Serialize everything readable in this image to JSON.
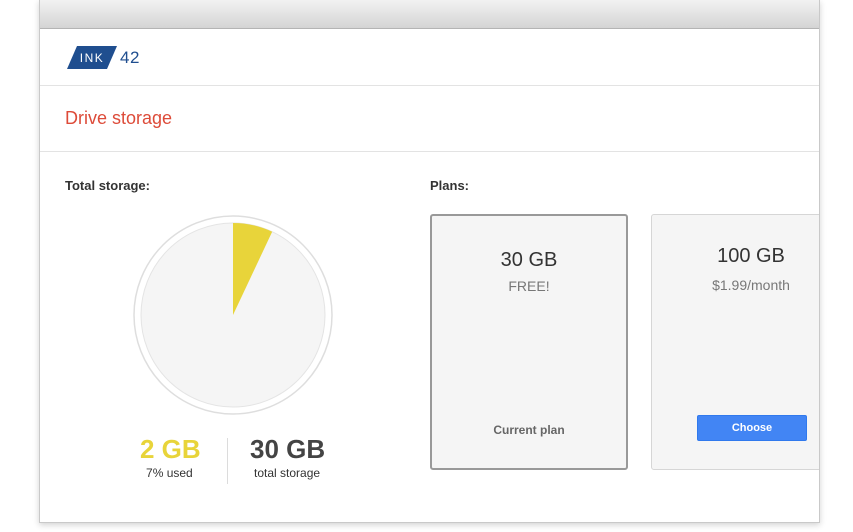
{
  "logo": {
    "mark_text": "INK",
    "number_text": "42"
  },
  "page_title": "Drive storage",
  "storage": {
    "label": "Total storage:",
    "used_value": "2 GB",
    "used_percent_text": "7",
    "used_suffix": "% used",
    "used_fraction": 0.07,
    "total_value": "30 GB",
    "total_caption": "total storage"
  },
  "plans": {
    "label": "Plans:",
    "items": [
      {
        "size": "30 GB",
        "price": "FREE!",
        "status": "Current plan"
      },
      {
        "size": "100 GB",
        "price": "$1.99/month",
        "action": "Choose"
      }
    ]
  },
  "colors": {
    "accent_red": "#dd4b39",
    "used_yellow": "#e8d43a",
    "brand_blue": "#1f4e8f",
    "button_blue": "#4285f4"
  }
}
